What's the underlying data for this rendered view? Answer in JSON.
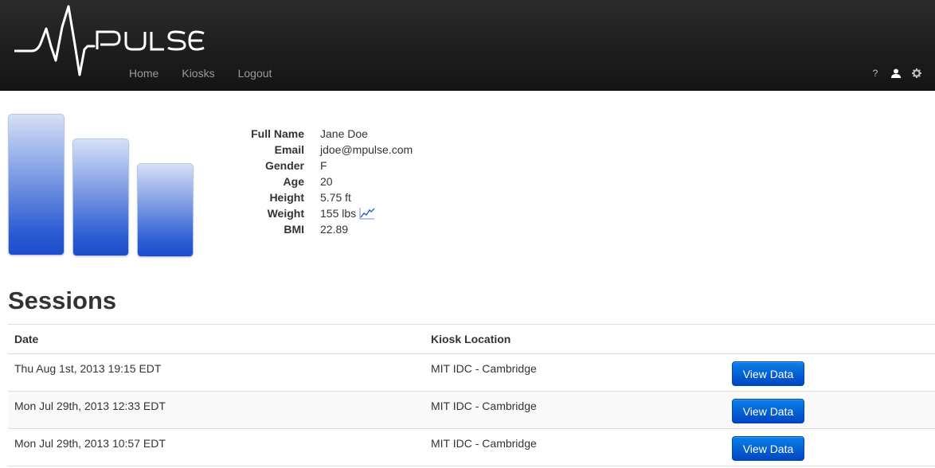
{
  "brand": {
    "name": "Pulse",
    "logo_text": "PULSE"
  },
  "nav": {
    "links": [
      "Home",
      "Kiosks",
      "Logout"
    ],
    "right_icons": [
      "help-icon",
      "user-icon",
      "gear-icon"
    ],
    "help_label": "?"
  },
  "profile": {
    "bar_levels": [
      1.0,
      0.83,
      0.66
    ],
    "fields": [
      {
        "label": "Full Name",
        "value": "Jane Doe"
      },
      {
        "label": "Email",
        "value": "jdoe@mpulse.com"
      },
      {
        "label": "Gender",
        "value": "F"
      },
      {
        "label": "Age",
        "value": "20"
      },
      {
        "label": "Height",
        "value": "5.75 ft"
      },
      {
        "label": "Weight",
        "value": "155 lbs"
      },
      {
        "label": "BMI",
        "value": "22.89"
      }
    ]
  },
  "sessions": {
    "title": "Sessions",
    "columns": [
      "Date",
      "Kiosk Location",
      ""
    ],
    "rows": [
      {
        "date": "Thu Aug 1st, 2013 19:15 EDT",
        "location": "MIT IDC - Cambridge",
        "action": "View Data"
      },
      {
        "date": "Mon Jul 29th, 2013 12:33 EDT",
        "location": "MIT IDC - Cambridge",
        "action": "View Data"
      },
      {
        "date": "Mon Jul 29th, 2013 10:57 EDT",
        "location": "MIT IDC - Cambridge",
        "action": "View Data"
      }
    ]
  },
  "colors": {
    "navbar": "#1b1b1b",
    "accent": "#0a6fd9",
    "bar_gradient_top": "#d6e0f6",
    "bar_gradient_bottom": "#1e4ccc"
  }
}
